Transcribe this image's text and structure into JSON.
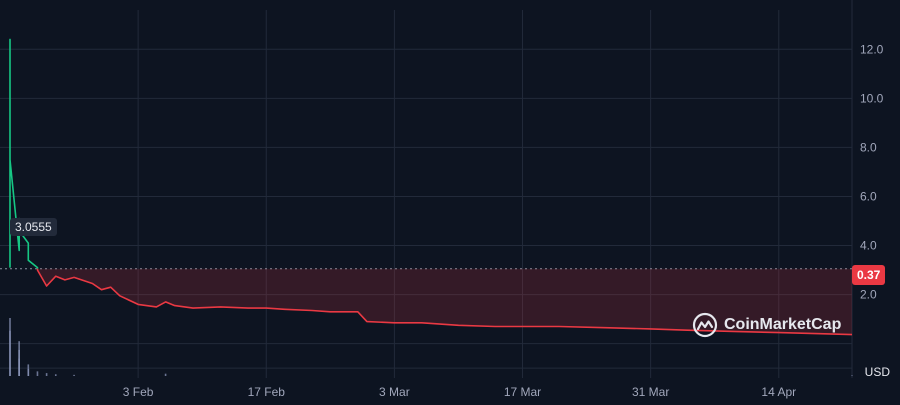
{
  "chart_data": {
    "type": "line",
    "currency": "USD",
    "reference_price": "3.0555",
    "current_price": "0.37",
    "y_ticks": [
      "12.0",
      "10.0",
      "8.0",
      "6.0",
      "4.0",
      "2.0"
    ],
    "y_range": [
      -1.4,
      13.6
    ],
    "x_range": [
      "2025-01-20",
      "2025-04-22"
    ],
    "x_ticks": [
      {
        "date": "2025-02-03",
        "label": "3 Feb"
      },
      {
        "date": "2025-02-17",
        "label": "17 Feb"
      },
      {
        "date": "2025-03-03",
        "label": "3 Mar"
      },
      {
        "date": "2025-03-17",
        "label": "17 Mar"
      },
      {
        "date": "2025-03-31",
        "label": "31 Mar"
      },
      {
        "date": "2025-04-14",
        "label": "14 Apr"
      }
    ],
    "series": [
      {
        "points": [
          [
            "2025-01-20",
            3.1
          ],
          [
            "2025-01-20",
            9.0
          ],
          [
            "2025-01-20",
            12.4
          ],
          [
            "2025-01-20",
            7.5
          ],
          [
            "2025-01-21",
            3.8
          ],
          [
            "2025-01-21",
            4.0
          ],
          [
            "2025-01-21",
            5.1
          ],
          [
            "2025-01-21",
            4.2
          ],
          [
            "2025-01-21",
            4.6
          ],
          [
            "2025-01-22",
            4.1
          ],
          [
            "2025-01-22",
            3.8
          ],
          [
            "2025-01-22",
            3.5
          ],
          [
            "2025-01-22",
            3.4
          ],
          [
            "2025-01-23",
            3.1
          ],
          [
            "2025-01-23",
            3.0
          ],
          [
            "2025-01-24",
            2.35
          ],
          [
            "2025-01-25",
            2.75
          ],
          [
            "2025-01-26",
            2.6
          ],
          [
            "2025-01-27",
            2.7
          ],
          [
            "2025-01-29",
            2.45
          ],
          [
            "2025-01-30",
            2.2
          ],
          [
            "2025-01-31",
            2.3
          ],
          [
            "2025-02-01",
            1.95
          ],
          [
            "2025-02-03",
            1.6
          ],
          [
            "2025-02-05",
            1.5
          ],
          [
            "2025-02-06",
            1.7
          ],
          [
            "2025-02-07",
            1.55
          ],
          [
            "2025-02-09",
            1.45
          ],
          [
            "2025-02-12",
            1.5
          ],
          [
            "2025-02-15",
            1.45
          ],
          [
            "2025-02-17",
            1.45
          ],
          [
            "2025-02-19",
            1.4
          ],
          [
            "2025-02-22",
            1.35
          ],
          [
            "2025-02-24",
            1.3
          ],
          [
            "2025-02-27",
            1.3
          ],
          [
            "2025-02-28",
            0.9
          ],
          [
            "2025-03-03",
            0.85
          ],
          [
            "2025-03-06",
            0.85
          ],
          [
            "2025-03-10",
            0.75
          ],
          [
            "2025-03-14",
            0.7
          ],
          [
            "2025-03-17",
            0.7
          ],
          [
            "2025-03-21",
            0.7
          ],
          [
            "2025-03-26",
            0.65
          ],
          [
            "2025-03-31",
            0.6
          ],
          [
            "2025-04-04",
            0.55
          ],
          [
            "2025-04-09",
            0.5
          ],
          [
            "2025-04-14",
            0.45
          ],
          [
            "2025-04-19",
            0.4
          ],
          [
            "2025-04-22",
            0.37
          ]
        ]
      }
    ],
    "volume": {
      "points": [
        [
          "2025-01-20",
          1.0
        ],
        [
          "2025-01-20",
          0.78
        ],
        [
          "2025-01-21",
          0.6
        ],
        [
          "2025-01-21",
          0.45
        ],
        [
          "2025-01-21",
          0.3
        ],
        [
          "2025-01-22",
          0.2
        ],
        [
          "2025-01-22",
          0.12
        ],
        [
          "2025-01-23",
          0.08
        ],
        [
          "2025-01-24",
          0.05
        ],
        [
          "2025-01-25",
          0.03
        ],
        [
          "2025-01-27",
          0.02
        ],
        [
          "2025-02-06",
          0.04
        ],
        [
          "2025-04-22",
          0.01
        ]
      ]
    },
    "colors": {
      "up": "#16c784",
      "down": "#ea3943",
      "background": "#0d1421",
      "grid": "#222a3a",
      "volume": "#8a94b8"
    }
  },
  "watermark": {
    "text": "CoinMarketCap",
    "icon": "coinmarketcap-logo-icon"
  }
}
